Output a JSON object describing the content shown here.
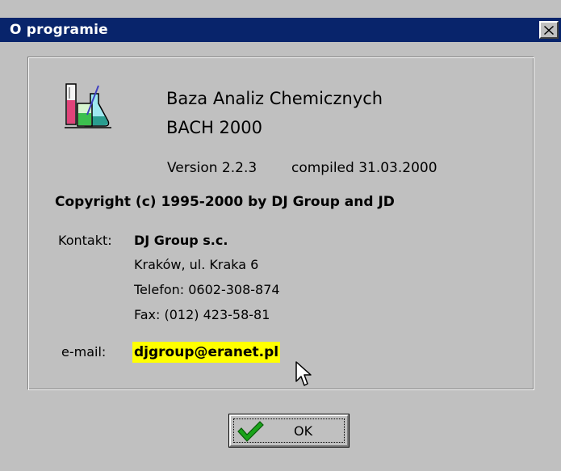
{
  "window": {
    "title": "O programie"
  },
  "product": {
    "name": "Baza Analiz Chemicznych",
    "edition": "BACH 2000",
    "version": "Version 2.2.3",
    "compiled": "compiled 31.03.2000"
  },
  "copyright": "Copyright (c) 1995-2000 by DJ Group and JD",
  "contact": {
    "label": "Kontakt:",
    "company": "DJ Group s.c.",
    "address": "Kraków, ul. Kraka 6",
    "phone": "Telefon: 0602-308-874",
    "fax": "Fax: (012) 423-58-81",
    "email_label": "e-mail:",
    "email": "djgroup@eranet.pl"
  },
  "buttons": {
    "ok_label": "OK"
  },
  "colors": {
    "titlebar": "#08246b",
    "dialog": "#c0c0c0",
    "email_highlight": "#ffff00"
  },
  "icons": [
    "close-icon",
    "lab-beakers-icon",
    "mouse-cursor-icon",
    "green-checkmark-icon"
  ]
}
